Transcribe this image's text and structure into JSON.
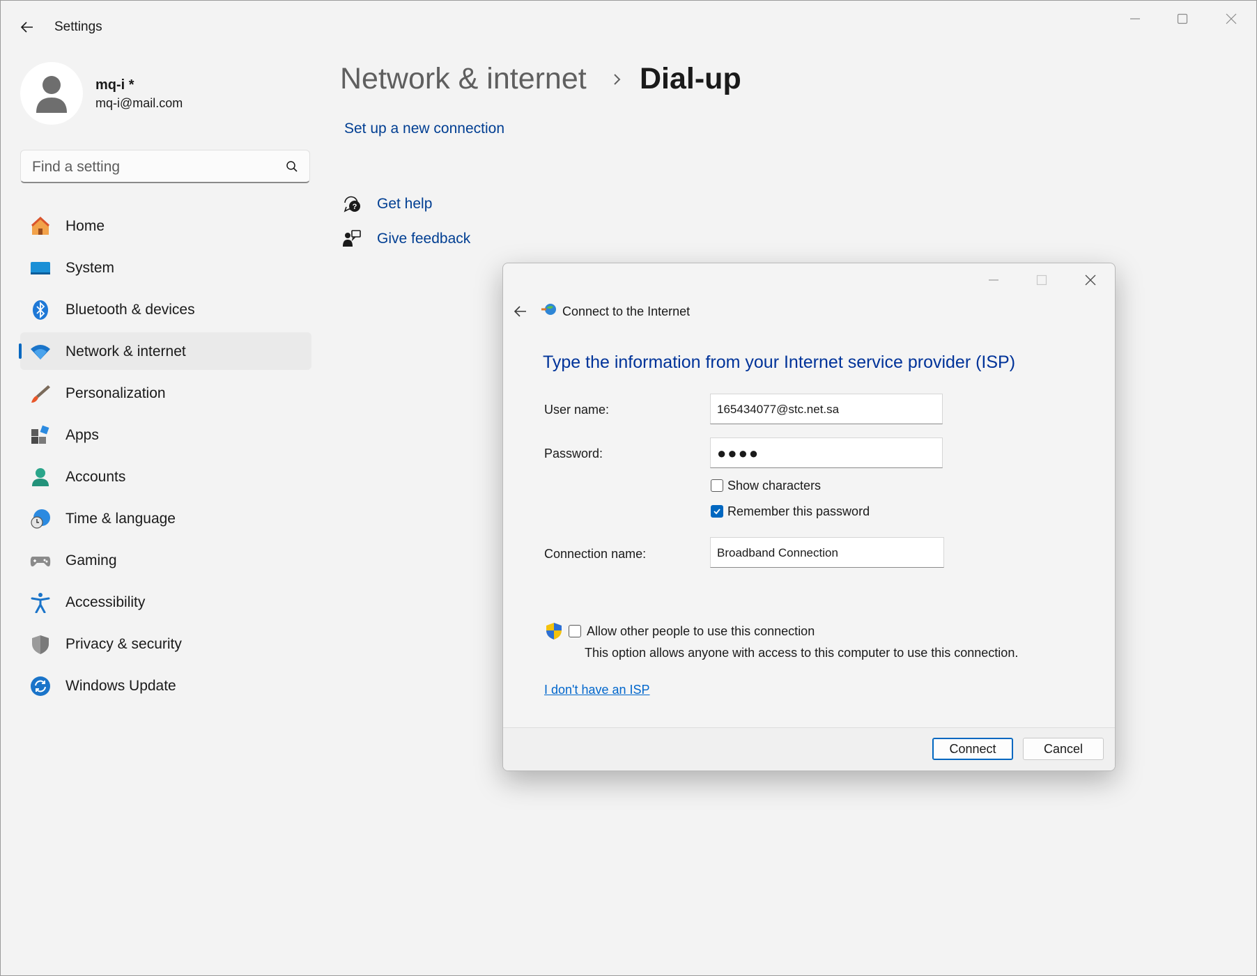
{
  "app": {
    "title": "Settings"
  },
  "profile": {
    "name": "mq-i *",
    "email": "mq-i@mail.com"
  },
  "search": {
    "placeholder": "Find a setting"
  },
  "nav": {
    "items": [
      {
        "label": "Home",
        "icon": "home-icon"
      },
      {
        "label": "System",
        "icon": "system-icon"
      },
      {
        "label": "Bluetooth & devices",
        "icon": "bluetooth-icon"
      },
      {
        "label": "Network & internet",
        "icon": "wifi-icon",
        "active": true
      },
      {
        "label": "Personalization",
        "icon": "brush-icon"
      },
      {
        "label": "Apps",
        "icon": "apps-icon"
      },
      {
        "label": "Accounts",
        "icon": "accounts-icon"
      },
      {
        "label": "Time & language",
        "icon": "globe-clock-icon"
      },
      {
        "label": "Gaming",
        "icon": "gamepad-icon"
      },
      {
        "label": "Accessibility",
        "icon": "accessibility-icon"
      },
      {
        "label": "Privacy & security",
        "icon": "shield-icon"
      },
      {
        "label": "Windows Update",
        "icon": "update-icon"
      }
    ]
  },
  "main": {
    "breadcrumb_parent": "Network & internet",
    "breadcrumb_current": "Dial-up",
    "setup_link": "Set up a new connection",
    "get_help": "Get help",
    "give_feedback": "Give feedback"
  },
  "dialog": {
    "title": "Connect to the Internet",
    "heading": "Type the information from your Internet service provider (ISP)",
    "username_label": "User name:",
    "username_value": "165434077@stc.net.sa",
    "password_label": "Password:",
    "password_value": "●●●●",
    "show_characters_label": "Show characters",
    "show_characters_checked": false,
    "remember_password_label": "Remember this password",
    "remember_password_checked": true,
    "connection_name_label": "Connection name:",
    "connection_name_value": "Broadband Connection",
    "allow_others_label": "Allow other people to use this connection",
    "allow_others_checked": false,
    "allow_others_hint": "This option allows anyone with access to this computer to use this connection.",
    "no_isp_link": "I don't have an ISP",
    "connect_button": "Connect",
    "cancel_button": "Cancel"
  },
  "colors": {
    "accent": "#0067c0",
    "link": "#003e92",
    "dialog_heading": "#003399"
  }
}
